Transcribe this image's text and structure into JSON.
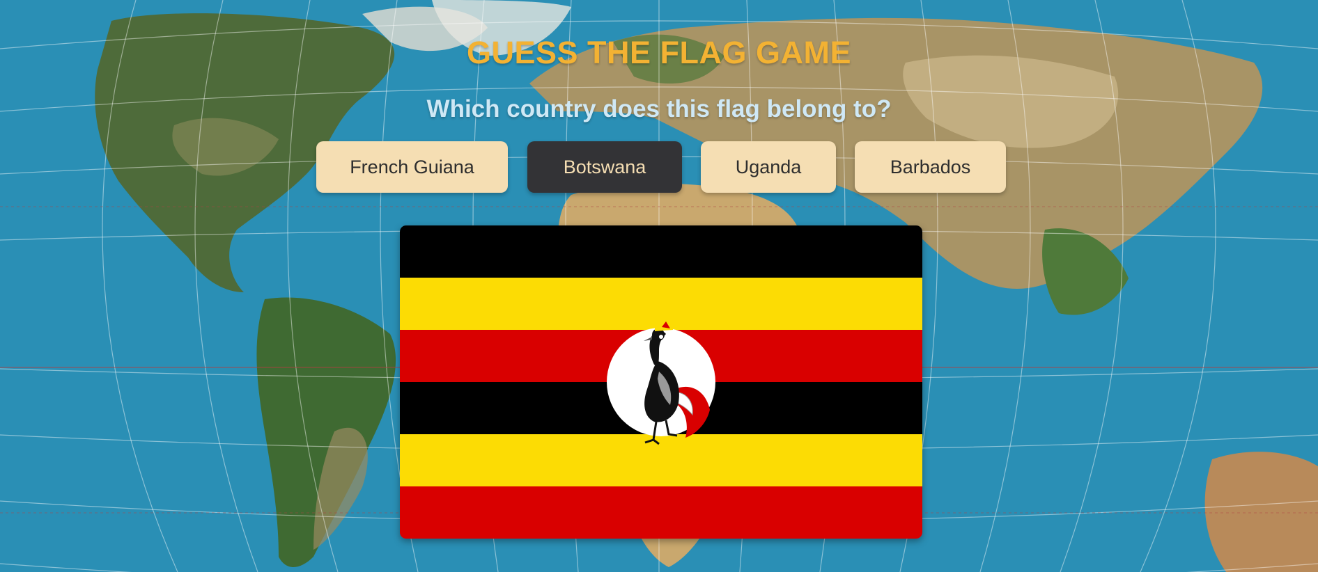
{
  "game": {
    "title": "GUESS THE FLAG GAME",
    "question": "Which country does this flag belong to?"
  },
  "options": [
    {
      "label": "French Guiana",
      "selected": false
    },
    {
      "label": "Botswana",
      "selected": true
    },
    {
      "label": "Uganda",
      "selected": false
    },
    {
      "label": "Barbados",
      "selected": false
    }
  ],
  "flag": {
    "emblem": "grey-crowned-crane",
    "stripe_colors": [
      "#000000",
      "#FCDC04",
      "#D90000",
      "#000000",
      "#FCDC04",
      "#D90000"
    ]
  },
  "colors": {
    "title": "#f3b233",
    "question": "#cfe8f5",
    "option_bg": "#f5deb3",
    "option_selected_bg": "#333336",
    "ocean": "#2a8fb5"
  },
  "background": {
    "type": "world-map-satellite"
  }
}
